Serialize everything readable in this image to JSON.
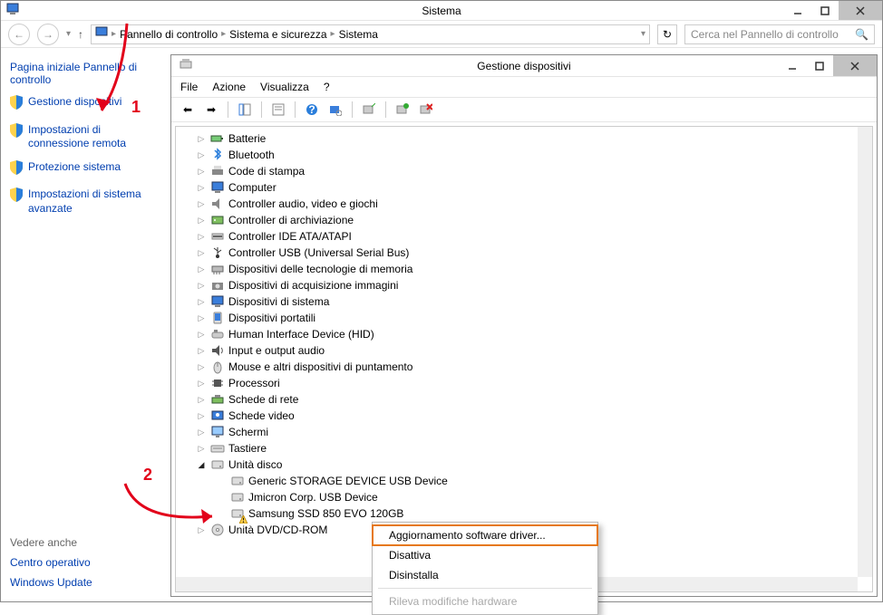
{
  "system": {
    "title": "Sistema",
    "breadcrumb": [
      "Pannello di controllo",
      "Sistema e sicurezza",
      "Sistema"
    ],
    "search_placeholder": "Cerca nel Pannello di controllo",
    "sidebar_header": "Pagina iniziale Pannello di controllo",
    "sidebar_links": [
      "Gestione dispositivi",
      "Impostazioni di connessione remota",
      "Protezione sistema",
      "Impostazioni di sistema avanzate"
    ],
    "see_also_header": "Vedere anche",
    "see_also": [
      "Centro operativo",
      "Windows Update"
    ]
  },
  "devmgr": {
    "title": "Gestione dispositivi",
    "menu": [
      "File",
      "Azione",
      "Visualizza",
      "?"
    ],
    "categories": [
      {
        "label": "Batterie",
        "icon": "battery"
      },
      {
        "label": "Bluetooth",
        "icon": "bluetooth"
      },
      {
        "label": "Code di stampa",
        "icon": "printer"
      },
      {
        "label": "Computer",
        "icon": "computer"
      },
      {
        "label": "Controller audio, video e giochi",
        "icon": "audio"
      },
      {
        "label": "Controller di archiviazione",
        "icon": "storage"
      },
      {
        "label": "Controller IDE ATA/ATAPI",
        "icon": "ide"
      },
      {
        "label": "Controller USB (Universal Serial Bus)",
        "icon": "usb"
      },
      {
        "label": "Dispositivi delle tecnologie di memoria",
        "icon": "mem"
      },
      {
        "label": "Dispositivi di acquisizione immagini",
        "icon": "camera"
      },
      {
        "label": "Dispositivi di sistema",
        "icon": "system"
      },
      {
        "label": "Dispositivi portatili",
        "icon": "portable"
      },
      {
        "label": "Human Interface Device (HID)",
        "icon": "hid"
      },
      {
        "label": "Input e output audio",
        "icon": "speaker"
      },
      {
        "label": "Mouse e altri dispositivi di puntamento",
        "icon": "mouse"
      },
      {
        "label": "Processori",
        "icon": "cpu"
      },
      {
        "label": "Schede di rete",
        "icon": "net"
      },
      {
        "label": "Schede video",
        "icon": "gpu"
      },
      {
        "label": "Schermi",
        "icon": "monitor"
      },
      {
        "label": "Tastiere",
        "icon": "keyboard"
      }
    ],
    "disk_cat": "Unità disco",
    "disks": [
      {
        "label": "Generic STORAGE DEVICE USB Device",
        "warn": false
      },
      {
        "label": "Jmicron Corp. USB Device",
        "warn": false
      },
      {
        "label": "Samsung SSD 850 EVO 120GB",
        "warn": true
      }
    ],
    "dvd_cat": "Unità DVD/CD-ROM"
  },
  "context_menu": {
    "items": [
      "Aggiornamento software driver...",
      "Disattiva",
      "Disinstalla",
      "Rileva modifiche hardware"
    ]
  },
  "annotations": {
    "one": "1",
    "two": "2"
  }
}
